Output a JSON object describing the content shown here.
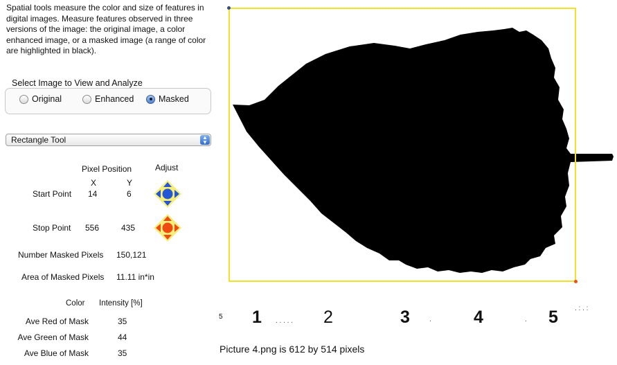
{
  "description": "Spatial tools measure the color and size of features in digital images.  Measure features observed in three versions of the image: the original image, a color enhanced image, or a masked image (a range of color are highlighted in black).",
  "image_select": {
    "label": "Select Image to View and Analyze",
    "options": [
      "Original",
      "Enhanced",
      "Masked"
    ],
    "selected": "Masked"
  },
  "tool_select": {
    "value": "Rectangle Tool"
  },
  "position": {
    "header": "Pixel Position",
    "adjust_header": "Adjust",
    "x_label": "X",
    "y_label": "Y",
    "start": {
      "label": "Start Point",
      "x": "14",
      "y": "6"
    },
    "stop": {
      "label": "Stop Point",
      "x": "556",
      "y": "435"
    }
  },
  "stats": {
    "masked_pixels_label": "Number Masked Pixels",
    "masked_pixels_value": "150,121",
    "area_label": "Area of Masked Pixels",
    "area_value": "11.11 in*in"
  },
  "color_table": {
    "color_header": "Color",
    "intensity_header": "Intensity [%]",
    "rows": [
      {
        "label": "Ave Red of Mask",
        "value": "35"
      },
      {
        "label": "Ave Green of Mask",
        "value": "44"
      },
      {
        "label": "Ave Blue of Mask",
        "value": "35"
      }
    ]
  },
  "ruler": {
    "small": "5",
    "marks": [
      "1",
      "2",
      "3",
      "4",
      "5"
    ]
  },
  "caption": "Picture 4.png is 612 by 514 pixels",
  "colors": {
    "selection_frame": "#f0e229",
    "start_adjust": "#2456d6",
    "stop_adjust": "#ee4a12",
    "mask": "#000000"
  },
  "icons": {
    "start_adjust": "blue-diamond-adjust-icon",
    "stop_adjust": "orange-diamond-adjust-icon",
    "select_arrows": "up-down-arrows-icon"
  }
}
